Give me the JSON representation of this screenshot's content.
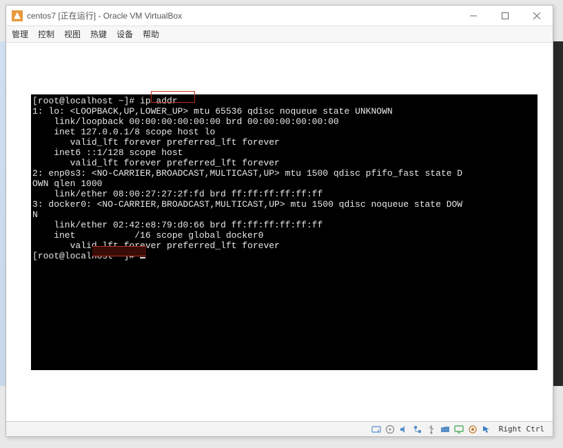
{
  "window": {
    "title": "centos7 [正在运行] - Oracle VM VirtualBox"
  },
  "menu": {
    "items": [
      "管理",
      "控制",
      "视图",
      "热键",
      "设备",
      "帮助"
    ]
  },
  "terminal": {
    "prompt1": "[root@localhost ~]# ",
    "cmd": "ip addr",
    "lines": [
      "1: lo: <LOOPBACK,UP,LOWER_UP> mtu 65536 qdisc noqueue state UNKNOWN",
      "    link/loopback 00:00:00:00:00:00 brd 00:00:00:00:00:00",
      "    inet 127.0.0.1/8 scope host lo",
      "       valid_lft forever preferred_lft forever",
      "    inet6 ::1/128 scope host",
      "       valid_lft forever preferred_lft forever",
      "2: enp0s3: <NO-CARRIER,BROADCAST,MULTICAST,UP> mtu 1500 qdisc pfifo_fast state D",
      "OWN qlen 1000",
      "    link/ether 08:00:27:27:2f:fd brd ff:ff:ff:ff:ff:ff",
      "3: docker0: <NO-CARRIER,BROADCAST,MULTICAST,UP> mtu 1500 qdisc noqueue state DOW",
      "N",
      "    link/ether 02:42:e8:79:d0:66 brd ff:ff:ff:ff:ff:ff",
      "    inet           /16 scope global docker0",
      "       valid_lft forever preferred_lft forever"
    ],
    "prompt2": "[root@localhost ~]# "
  },
  "status": {
    "host_key": "Right Ctrl"
  },
  "colors": {
    "terminal_bg": "#000000",
    "terminal_fg": "#e8e8e8",
    "annotation": "#c03020"
  }
}
